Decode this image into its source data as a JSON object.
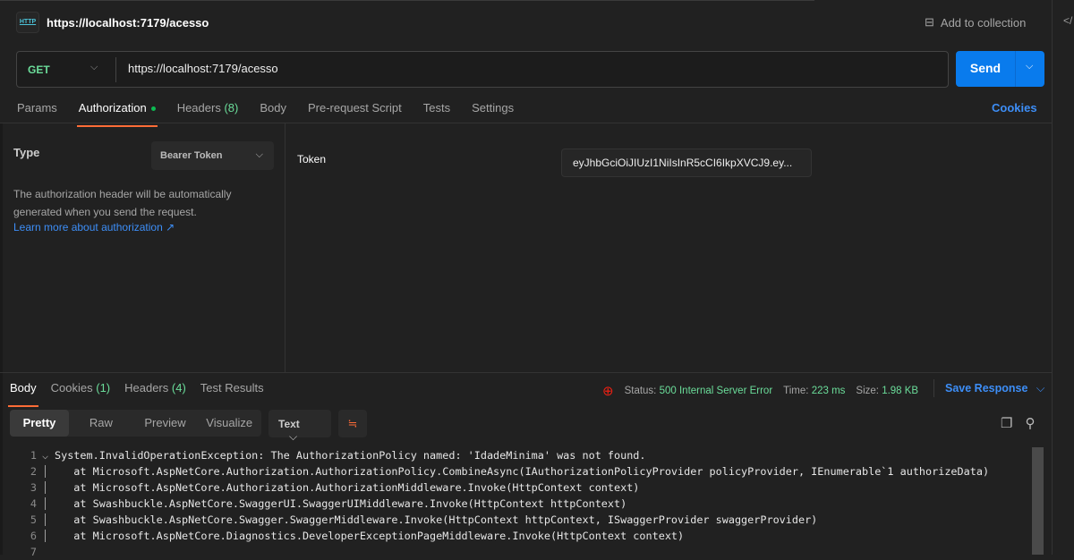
{
  "header": {
    "icon": "http-icon",
    "icon_text": "HTTP",
    "title": "https://localhost:7179/acesso",
    "add_to_collection": "Add to collection",
    "side_icon": "</"
  },
  "request": {
    "method": "GET",
    "url": "https://localhost:7179/acesso",
    "send": "Send"
  },
  "tabs": [
    {
      "label": "Params"
    },
    {
      "label": "Authorization",
      "active": true
    },
    {
      "label": "Headers",
      "count": "(8)"
    },
    {
      "label": "Body"
    },
    {
      "label": "Pre-request Script"
    },
    {
      "label": "Tests"
    },
    {
      "label": "Settings"
    }
  ],
  "cookies_link": "Cookies",
  "auth": {
    "type_label": "Type",
    "type_value": "Bearer Token",
    "description": "The authorization header will be automatically generated when you send the request.",
    "learn_more": "Learn more about authorization ↗",
    "token_label": "Token",
    "token_value": "eyJhbGciOiJIUzI1NiIsInR5cCI6IkpXVCJ9.ey..."
  },
  "response": {
    "tabs": [
      {
        "label": "Body",
        "active": true
      },
      {
        "label": "Cookies",
        "count": "(1)"
      },
      {
        "label": "Headers",
        "count": "(4)"
      },
      {
        "label": "Test Results"
      }
    ],
    "status_label": "Status:",
    "status_value": "500 Internal Server Error",
    "time_label": "Time:",
    "time_value": "223 ms",
    "size_label": "Size:",
    "size_value": "1.98 KB",
    "save": "Save Response",
    "views": [
      "Pretty",
      "Raw",
      "Preview",
      "Visualize"
    ],
    "format": "Text",
    "lines": [
      "System.InvalidOperationException: The AuthorizationPolicy named: 'IdadeMinima' was not found.",
      "   at Microsoft.AspNetCore.Authorization.AuthorizationPolicy.CombineAsync(IAuthorizationPolicyProvider policyProvider, IEnumerable`1 authorizeData)",
      "   at Microsoft.AspNetCore.Authorization.AuthorizationMiddleware.Invoke(HttpContext context)",
      "   at Swashbuckle.AspNetCore.SwaggerUI.SwaggerUIMiddleware.Invoke(HttpContext httpContext)",
      "   at Swashbuckle.AspNetCore.Swagger.SwaggerMiddleware.Invoke(HttpContext httpContext, ISwaggerProvider swaggerProvider)",
      "   at Microsoft.AspNetCore.Diagnostics.DeveloperExceptionPageMiddleware.Invoke(HttpContext context)",
      ""
    ]
  },
  "colors": {
    "accent": "#ff6c37",
    "send": "#097bed",
    "link": "#3d8ef7",
    "success": "#6bdd9a",
    "error": "#eb2013"
  }
}
